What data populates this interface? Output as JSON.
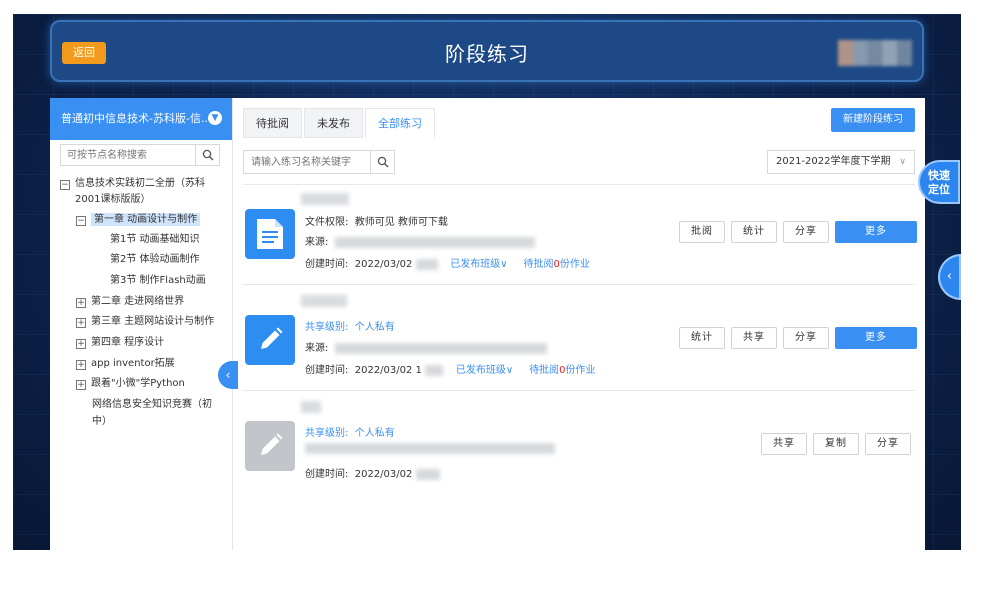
{
  "header": {
    "back_label": "返回",
    "title": "阶段练习"
  },
  "sidebar": {
    "course": "普通初中信息技术-苏科版-信...",
    "search_placeholder": "可按节点名称搜索",
    "tree": {
      "root": "信息技术实践初二全册（苏科",
      "root_line2": "2001课标版版）",
      "ch1": "第一章 动画设计与制作",
      "s1": "第1节 动画基础知识",
      "s2": "第2节 体验动画制作",
      "s3": "第3节 制作Flash动画",
      "ch2": "第二章 走进网络世界",
      "ch3": "第三章 主题网站设计与制作",
      "ch4": "第四章 程序设计",
      "ext1": "app inventor拓展",
      "ext2": "跟着\"小微\"学Python",
      "ext3": "网络信息安全知识竞赛（初",
      "ext3_line2": "中）"
    }
  },
  "tabs": [
    "待批阅",
    "未发布",
    "全部练习"
  ],
  "new_button": "新建阶段练习",
  "search_placeholder": "请输入练习名称关键字",
  "term": "2021-2022学年度下学期",
  "cards": [
    {
      "perm_label": "文件权限:",
      "perm_value": "教师可见  教师可下载",
      "source_label": "来源:",
      "created_label": "创建时间:",
      "created": "2022/03/02",
      "published": "已发布班级",
      "pending_pre": "待批阅",
      "pending_num": "0",
      "pending_post": "份作业",
      "actions": [
        "批阅",
        "统计",
        "分享",
        "更多"
      ]
    },
    {
      "share_label": "共享级别:",
      "share_value": "个人私有",
      "source_label": "来源:",
      "created_label": "创建时间:",
      "created": "2022/03/02 1",
      "published": "已发布班级",
      "pending_pre": "待批阅",
      "pending_num": "0",
      "pending_post": "份作业",
      "actions": [
        "统计",
        "共享",
        "分享",
        "更多"
      ]
    },
    {
      "share_label": "共享级别:",
      "share_value": "个人私有",
      "created_label": "创建时间:",
      "created": "2022/03/02",
      "actions": [
        "共享",
        "复制",
        "分享"
      ]
    }
  ],
  "quick_locate": "快速定位",
  "colors": {
    "accent": "#3a8ff2",
    "back": "#f29a1b",
    "header": "#1d4a86"
  }
}
